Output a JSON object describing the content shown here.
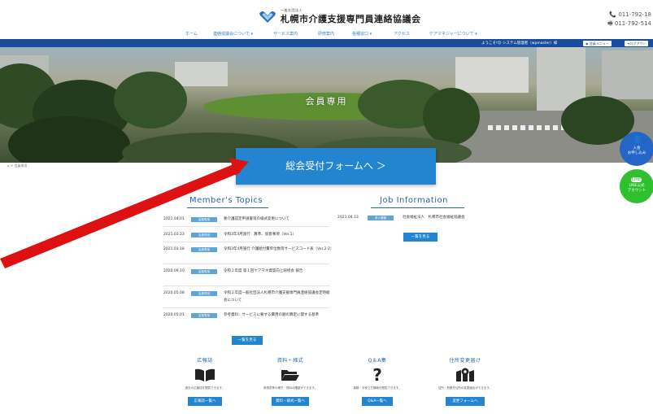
{
  "header": {
    "logo_sub": "一般社団法人",
    "logo_title": "札幌市介護支援専門員連絡協議会",
    "phone": "011-792-18",
    "fax": "011-792-514"
  },
  "nav": {
    "items": [
      {
        "label": "ホーム"
      },
      {
        "label": "連絡協議会について ▾"
      },
      {
        "label": "サービス案内"
      },
      {
        "label": "研修案内"
      },
      {
        "label": "各種窓口 ▾"
      },
      {
        "label": "アクセス"
      },
      {
        "label": "ケアマネジャーについて ▾"
      }
    ]
  },
  "admin_bar": {
    "welcome": "ようこそ!😊 システム管理者（wpmaster）様",
    "menu_button": "会員メニュー",
    "logout_button": "ログアウト"
  },
  "hero": {
    "title": "会員専用"
  },
  "side_buttons": {
    "join": "入会\nお申し込み",
    "line_top": "LINE",
    "line": "LINE公式\nアカウント"
  },
  "breadcrumb": "会員専用",
  "cta": {
    "label": "総会受付フォームへ ＞"
  },
  "members_topics": {
    "title": "Member's Topics",
    "items": [
      {
        "date": "2021.04.01",
        "badge": "会員専用",
        "title": "要介護認定申請書等の様式変更について"
      },
      {
        "date": "2021.03.23",
        "badge": "会員専用",
        "title": "令和3年4月施行　算準、留意事項（Ver.1）"
      },
      {
        "date": "2021.03.18",
        "badge": "会員専用",
        "title": "令和3年4月施行 介護給付費単位数等サービスコード表（Ver.2-2）"
      },
      {
        "date": "2020.09.10",
        "badge": "会員専用",
        "title": "令和２年度 第１回ケアマネ資質向上研修会 報告"
      },
      {
        "date": "2020.05.08",
        "badge": "会員専用",
        "title": "令和２年度一般社団法人札幌市介護支援専門員連絡協議会定時総会について"
      },
      {
        "date": "2020.05.01",
        "badge": "会員専用",
        "title": "参考資料：サービスに要する費用の額の算定に関する基準"
      }
    ],
    "more_button": "一覧を見る"
  },
  "job_info": {
    "title": "Job Information",
    "items": [
      {
        "date": "2021.04.13",
        "badge": "求人情報",
        "title": "社会福祉法人　札幌市社会福祉協議会"
      }
    ],
    "more_button": "一覧を見る"
  },
  "cards": [
    {
      "title": "広報誌",
      "icon": "book-icon",
      "desc": "過去の広報誌を閲覧できます。",
      "button": "広報誌一覧へ"
    },
    {
      "title": "資料・様式",
      "icon": "folder-icon",
      "desc": "申請書等の様式・資料の確認ができます。",
      "button": "資料・様式一覧へ"
    },
    {
      "title": "Q＆A集",
      "icon": "question-icon",
      "desc": "事務・お役立ち情報を閲覧できます。",
      "button": "Q&A一覧へ"
    },
    {
      "title": "住所変更届け",
      "icon": "map-icon",
      "desc": "住所・勤務先住所の変更届出ができます。",
      "button": "変更フォームへ"
    }
  ],
  "colors": {
    "brand_blue": "#2385cf",
    "admin_bar": "#1a4c9e",
    "annotation_red": "#dd1111",
    "line_green": "#2fbf2f"
  }
}
